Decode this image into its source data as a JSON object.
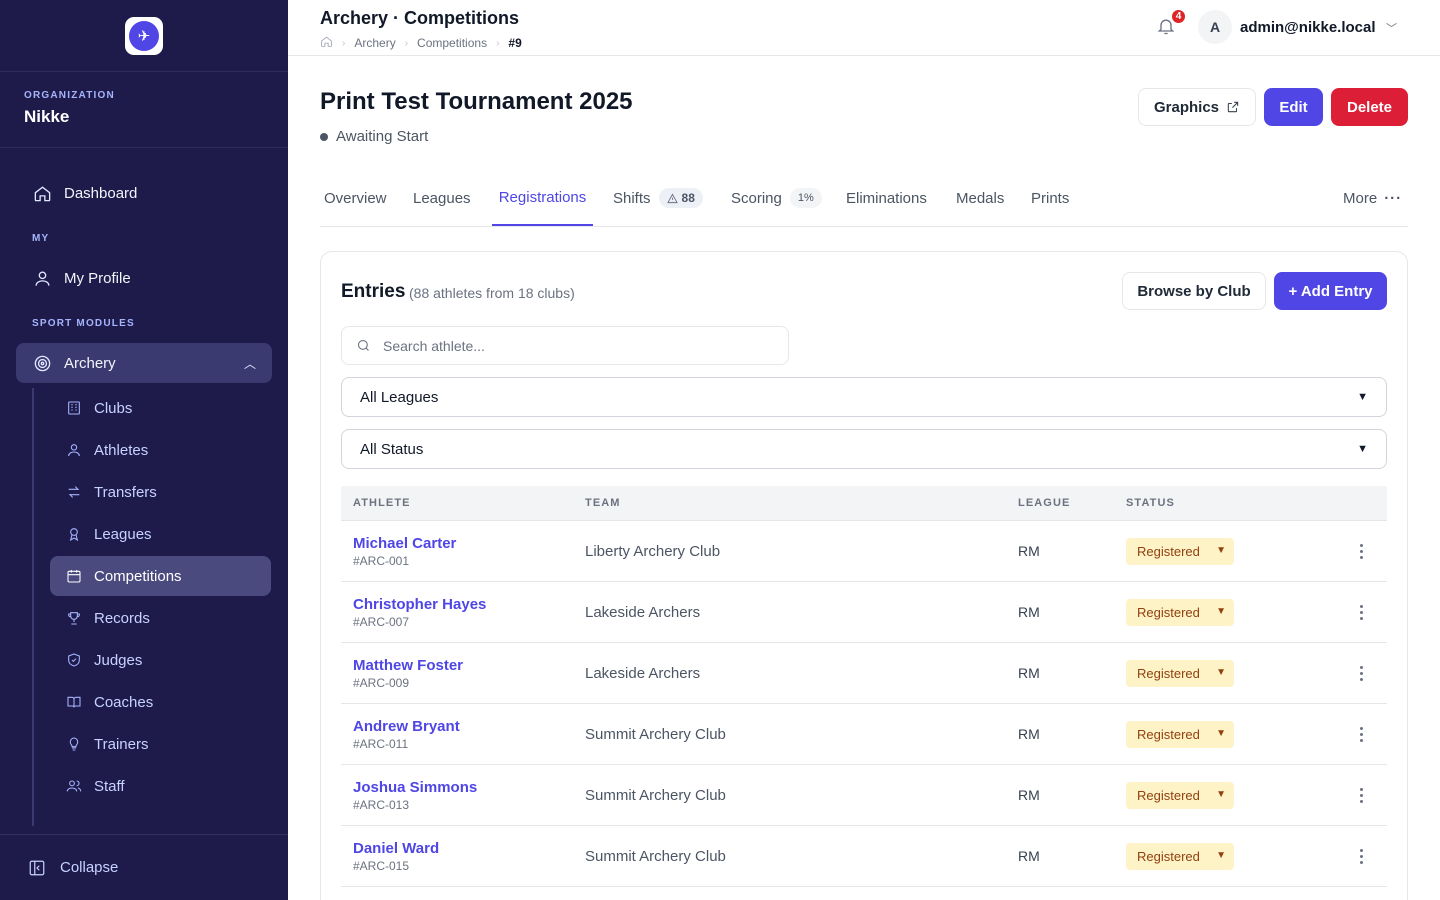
{
  "sidebar": {
    "org_label": "ORGANIZATION",
    "org_name": "Nikke",
    "dashboard": "Dashboard",
    "my_label": "MY",
    "my_profile": "My Profile",
    "sport_label": "SPORT MODULES",
    "archery": "Archery",
    "items": [
      {
        "label": "Clubs",
        "icon": "building-icon"
      },
      {
        "label": "Athletes",
        "icon": "user-icon"
      },
      {
        "label": "Transfers",
        "icon": "transfer-icon"
      },
      {
        "label": "Leagues",
        "icon": "ribbon-icon"
      },
      {
        "label": "Competitions",
        "icon": "calendar-icon"
      },
      {
        "label": "Records",
        "icon": "trophy-icon"
      },
      {
        "label": "Judges",
        "icon": "shield-icon"
      },
      {
        "label": "Coaches",
        "icon": "book-icon"
      },
      {
        "label": "Trainers",
        "icon": "bulb-icon"
      },
      {
        "label": "Staff",
        "icon": "users-icon"
      }
    ],
    "collapse": "Collapse"
  },
  "topbar": {
    "title": "Archery · Competitions",
    "breadcrumb": [
      "Archery",
      "Competitions",
      "#9"
    ],
    "notification_count": "4",
    "avatar_letter": "A",
    "user_email": "admin@nikke.local"
  },
  "page": {
    "title": "Print Test Tournament 2025",
    "status": "Awaiting Start",
    "graphics_label": "Graphics",
    "edit_label": "Edit",
    "delete_label": "Delete"
  },
  "tabs": {
    "overview": "Overview",
    "leagues": "Leagues",
    "registrations": "Registrations",
    "shifts": "Shifts",
    "shifts_badge": "88",
    "scoring": "Scoring",
    "scoring_badge": "1%",
    "eliminations": "Eliminations",
    "medals": "Medals",
    "prints": "Prints",
    "more": "More"
  },
  "entries": {
    "title": "Entries",
    "subtitle": "(88 athletes from 18 clubs)",
    "browse_label": "Browse by Club",
    "add_label": "+ Add Entry",
    "search_placeholder": "Search athlete...",
    "league_filter": "All Leagues",
    "status_filter": "All Status",
    "columns": {
      "athlete": "ATHLETE",
      "team": "TEAM",
      "league": "LEAGUE",
      "status": "STATUS"
    },
    "rows": [
      {
        "name": "Michael Carter",
        "id": "#ARC-001",
        "team": "Liberty Archery Club",
        "league": "RM",
        "status": "Registered"
      },
      {
        "name": "Christopher Hayes",
        "id": "#ARC-007",
        "team": "Lakeside Archers",
        "league": "RM",
        "status": "Registered"
      },
      {
        "name": "Matthew Foster",
        "id": "#ARC-009",
        "team": "Lakeside Archers",
        "league": "RM",
        "status": "Registered"
      },
      {
        "name": "Andrew Bryant",
        "id": "#ARC-011",
        "team": "Summit Archery Club",
        "league": "RM",
        "status": "Registered"
      },
      {
        "name": "Joshua Simmons",
        "id": "#ARC-013",
        "team": "Summit Archery Club",
        "league": "RM",
        "status": "Registered"
      },
      {
        "name": "Daniel Ward",
        "id": "#ARC-015",
        "team": "Summit Archery Club",
        "league": "RM",
        "status": "Registered"
      }
    ]
  }
}
